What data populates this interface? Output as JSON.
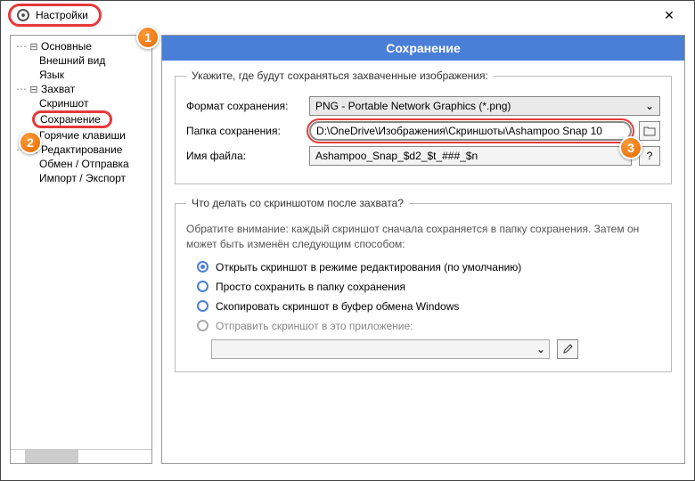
{
  "window": {
    "title": "Настройки"
  },
  "badges": {
    "b1": "1",
    "b2": "2",
    "b3": "3"
  },
  "sidebar": {
    "items": [
      {
        "label": "Основные"
      },
      {
        "label": "Внешний вид"
      },
      {
        "label": "Язык"
      },
      {
        "label": "Захват"
      },
      {
        "label": "Скриншот"
      },
      {
        "label": "Сохранение"
      },
      {
        "label": "Горячие клавиши"
      },
      {
        "label": "Редактирование"
      },
      {
        "label": "Обмен / Отправка"
      },
      {
        "label": "Импорт / Экспорт"
      }
    ]
  },
  "main": {
    "header": "Сохранение",
    "group1": {
      "legend": "Укажите, где будут сохраняться захваченные изображения:",
      "format_label": "Формат сохранения:",
      "format_value": "PNG - Portable Network Graphics (*.png)",
      "folder_label": "Папка сохранения:",
      "folder_value": "D:\\OneDrive\\Изображения\\Скриншоты\\Ashampoo Snap 10",
      "filename_label": "Имя файла:",
      "filename_value": "Ashampoo_Snap_$d2_$t_###_$n"
    },
    "group2": {
      "legend": "Что делать со скриншотом после захвата?",
      "note": "Обратите внимание: каждый скриншот сначала сохраняется в папку сохранения. Затем он может быть изменён следующим способом:",
      "r1": "Открыть скриншот в режиме редактирования (по умолчанию)",
      "r2": "Просто сохранить в папку сохранения",
      "r3": "Скопировать скриншот в буфер обмена Windows",
      "r4": "Отправить скриншот в это приложение:"
    }
  }
}
